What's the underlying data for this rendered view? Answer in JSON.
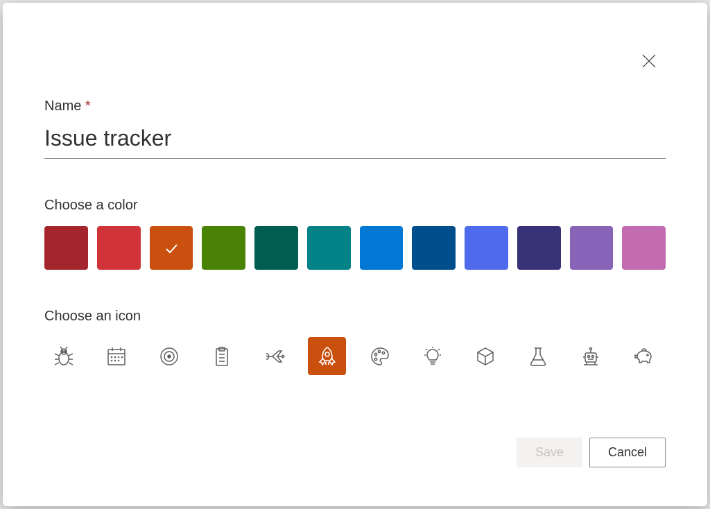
{
  "name_label": "Name",
  "required_mark": "*",
  "name_value": "Issue tracker",
  "color_label": "Choose a color",
  "colors": [
    {
      "hex": "#a4262c",
      "name": "dark-red"
    },
    {
      "hex": "#d13438",
      "name": "red"
    },
    {
      "hex": "#ca5010",
      "name": "orange",
      "selected": true
    },
    {
      "hex": "#498205",
      "name": "green"
    },
    {
      "hex": "#005e50",
      "name": "dark-teal"
    },
    {
      "hex": "#038387",
      "name": "teal"
    },
    {
      "hex": "#0078d4",
      "name": "blue"
    },
    {
      "hex": "#004e8c",
      "name": "dark-blue"
    },
    {
      "hex": "#4f6bed",
      "name": "periwinkle"
    },
    {
      "hex": "#373277",
      "name": "navy"
    },
    {
      "hex": "#8764b8",
      "name": "purple"
    },
    {
      "hex": "#c36bb0",
      "name": "pink"
    }
  ],
  "selected_color": "#ca5010",
  "icon_label": "Choose an icon",
  "icons": [
    "bug",
    "calendar",
    "target",
    "clipboard",
    "airplane",
    "rocket",
    "palette",
    "lightbulb",
    "cube",
    "flask",
    "robot",
    "piggy-bank"
  ],
  "selected_icon": "rocket",
  "save_label": "Save",
  "cancel_label": "Cancel"
}
